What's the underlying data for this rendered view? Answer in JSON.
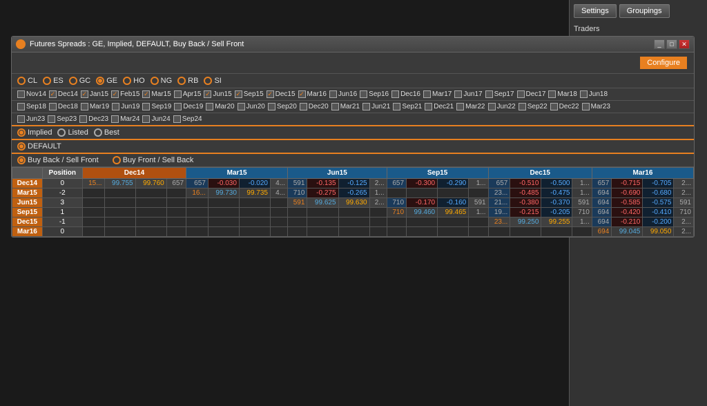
{
  "window": {
    "title": "Futures Spreads : GE, Implied, DEFAULT, Buy Back / Sell Front",
    "configure_label": "Configure"
  },
  "sidebar": {
    "settings_label": "Settings",
    "groupings_label": "Groupings",
    "traders_label": "Traders"
  },
  "toolbar": {
    "instruments": [
      "CL",
      "ES",
      "GC",
      "GE",
      "HO",
      "NG",
      "RB",
      "SI"
    ],
    "instrument_colors": [
      "#e88020",
      "#e88020",
      "#e88020",
      "#e88020",
      "#e88020",
      "#e88020",
      "#e88020",
      "#e88020"
    ],
    "pricing_options": [
      "Implied",
      "Listed",
      "Best"
    ],
    "default_label": "DEFAULT",
    "direction_options": [
      "Buy Back / Sell Front",
      "Buy Front / Sell Back"
    ]
  },
  "contracts": {
    "row1": [
      "Nov14",
      "Dec14",
      "Jan15",
      "Feb15",
      "Mar15",
      "Apr15",
      "Jun15",
      "Sep15",
      "Dec15",
      "Mar16",
      "Jun16",
      "Sep16",
      "Dec16",
      "Mar17",
      "Jun17",
      "Sep17",
      "Dec17",
      "Mar18",
      "Jun18"
    ],
    "row1_checked": [
      false,
      true,
      true,
      true,
      true,
      false,
      true,
      true,
      true,
      true,
      false,
      false,
      false,
      false,
      false,
      false,
      false,
      false,
      false
    ],
    "row2": [
      "Sep18",
      "Dec18",
      "Mar19",
      "Jun19",
      "Sep19",
      "Dec19",
      "Mar20",
      "Jun20",
      "Sep20",
      "Dec20",
      "Mar21",
      "Jun21",
      "Sep21",
      "Dec21",
      "Mar22",
      "Jun22",
      "Sep22",
      "Dec22",
      "Mar23"
    ],
    "row2_checked": [
      false,
      false,
      false,
      false,
      false,
      false,
      false,
      false,
      false,
      false,
      false,
      false,
      false,
      false,
      false,
      false,
      false,
      false,
      false
    ],
    "row3": [
      "Jun23",
      "Sep23",
      "Dec23",
      "Mar24",
      "Jun24",
      "Sep24"
    ],
    "row3_checked": [
      false,
      false,
      false,
      false,
      false,
      false
    ]
  },
  "table": {
    "row_headers": [
      "Dec14",
      "Mar15",
      "Jun15",
      "Sep15",
      "Dec15",
      "Mar16"
    ],
    "col_groups": [
      "Dec14",
      "Mar15",
      "Jun15",
      "Sep15",
      "Dec15",
      "Mar16"
    ],
    "rows": [
      {
        "label": "Dec14",
        "position": "0",
        "dec14": {
          "p1": "15...",
          "p2": "99.755",
          "p3": "99.760",
          "p4": "657"
        },
        "mar15": {
          "s1": "657",
          "d1": "-0.030",
          "d2": "-0.020",
          "p": "4..."
        },
        "jun15": {
          "s1": "591",
          "d1": "-0.135",
          "d2": "-0.125",
          "p": "2..."
        },
        "sep15": {
          "s1": "657",
          "d1": "-0.300",
          "d2": "-0.290",
          "p": "1..."
        },
        "dec15": {
          "s1": "657",
          "d1": "-0.510",
          "d2": "-0.500",
          "p": "1..."
        },
        "mar16": {
          "s1": "657",
          "d1": "-0.715",
          "d2": "-0.705",
          "p": "2..."
        }
      },
      {
        "label": "Mar15",
        "position": "-2",
        "dec14": {},
        "mar15": {
          "p1": "16...",
          "p2": "99.730",
          "p3": "99.735",
          "p4": "4..."
        },
        "jun15": {
          "s1": "710",
          "d1": "-0.275",
          "d2": "-0.265",
          "p": "1..."
        },
        "sep15": {},
        "dec15": {
          "s1": "23...",
          "d1": "-0.485",
          "d2": "-0.475",
          "p": "1..."
        },
        "mar16": {
          "s1": "694",
          "d1": "-0.690",
          "d2": "-0.680",
          "p": "2..."
        }
      },
      {
        "label": "Jun15",
        "position": "3",
        "dec14": {},
        "mar15": {},
        "jun15": {
          "p1": "591",
          "p2": "99.625",
          "p3": "99.630",
          "p4": "2..."
        },
        "sep15": {
          "s1": "710",
          "d1": "-0.170",
          "d2": "-0.160",
          "p": "591"
        },
        "dec15": {
          "s1": "21...",
          "d1": "-0.380",
          "d2": "-0.370",
          "p": "591"
        },
        "mar16": {
          "s1": "694",
          "d1": "-0.585",
          "d2": "-0.575",
          "p": "591"
        }
      },
      {
        "label": "Sep15",
        "position": "1",
        "dec14": {},
        "mar15": {},
        "jun15": {},
        "sep15": {
          "p1": "710",
          "p2": "99.460",
          "p3": "99.465",
          "p4": "1..."
        },
        "dec15": {
          "s1": "19...",
          "d1": "-0.215",
          "d2": "-0.205",
          "p": "710"
        },
        "mar16": {
          "s1": "694",
          "d1": "-0.420",
          "d2": "-0.410",
          "p": "710"
        }
      },
      {
        "label": "Dec15",
        "position": "-1",
        "dec14": {},
        "mar15": {},
        "jun15": {},
        "sep15": {},
        "dec15": {
          "p1": "23...",
          "p2": "99.250",
          "p3": "99.255",
          "p4": "1..."
        },
        "mar16": {
          "s1": "694",
          "d1": "-0.210",
          "d2": "-0.200",
          "p": "2..."
        }
      },
      {
        "label": "Mar16",
        "position": "0",
        "dec14": {},
        "mar15": {},
        "jun15": {},
        "sep15": {},
        "dec15": {},
        "mar16": {
          "p1": "694",
          "p2": "99.045",
          "p3": "99.050",
          "p4": "2..."
        }
      }
    ]
  }
}
